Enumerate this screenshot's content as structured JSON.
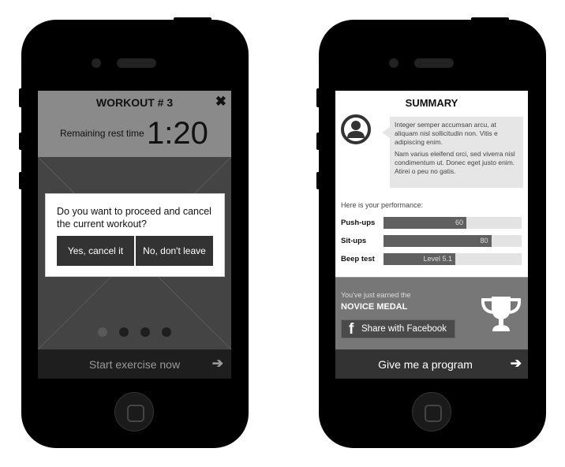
{
  "left_screen": {
    "title": "WORKOUT # 3",
    "rest_label": "Remaining rest time",
    "rest_time": "1:20",
    "close_icon": "close-x-icon",
    "dialog": {
      "message": "Do you want to proceed and cancel the current workout?",
      "confirm_label": "Yes, cancel it",
      "cancel_label": "No, don't leave"
    },
    "pager": {
      "count": 4,
      "active": 1
    },
    "footer": {
      "label": "Start exercise now",
      "icon": "arrow-right-icon"
    }
  },
  "right_screen": {
    "title": "SUMMARY",
    "avatar_icon": "user-avatar-icon",
    "message_p1": "Integer semper accumsan arcu, at aliquam nisl sollicitudin non. Vitis e adipiscing enim.",
    "message_p2": "Nam varius eleifend orci, sed viverra nisl condimentum ut. Donec eget justo enim. Atirei o peu no gatis.",
    "performance_label": "Here is your performance:",
    "stats": [
      {
        "label": "Push-ups",
        "value_text": "60",
        "percent": 60
      },
      {
        "label": "Sit-ups",
        "value_text": "80",
        "percent": 78
      },
      {
        "label": "Beep test",
        "value_text": "Level 5.1",
        "percent": 52
      }
    ],
    "medal": {
      "intro": "You've just earned the",
      "name": "NOVICE MEDAL",
      "share_label": "Share with Facebook",
      "share_icon": "facebook-icon",
      "trophy_icon": "trophy-icon"
    },
    "footer": {
      "label": "Give me a program",
      "icon": "arrow-right-icon"
    }
  }
}
